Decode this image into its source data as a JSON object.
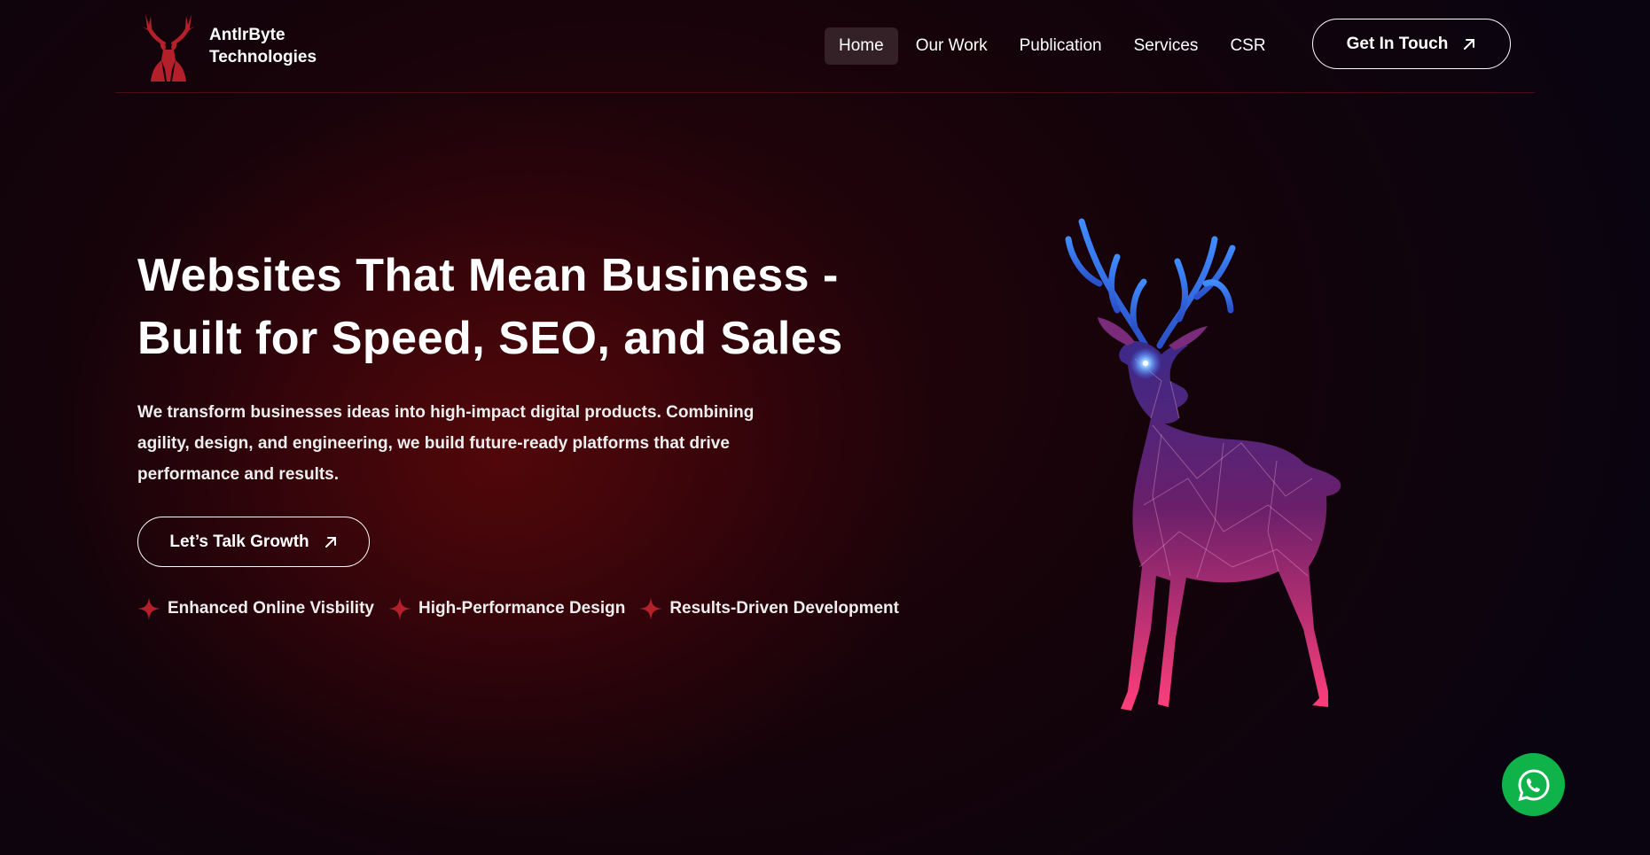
{
  "brand": {
    "name_line1": "AntlrByte",
    "name_line2": "Technologies",
    "logo_icon": "deer-head-icon",
    "accent_color": "#b3202a"
  },
  "nav": {
    "items": [
      {
        "label": "Home",
        "active": true
      },
      {
        "label": "Our Work",
        "active": false
      },
      {
        "label": "Publication",
        "active": false
      },
      {
        "label": "Services",
        "active": false
      },
      {
        "label": "CSR",
        "active": false
      }
    ],
    "cta_label": "Get In Touch",
    "cta_icon": "arrow-up-right-icon"
  },
  "hero": {
    "title_line1": "Websites That Mean Business -",
    "title_line2": "Built for Speed, SEO, and Sales",
    "description": "We transform businesses ideas into high-impact digital products. Combining agility, design, and engineering, we build future-ready platforms that drive performance and results.",
    "cta_label": "Let’s Talk Growth",
    "cta_icon": "arrow-up-right-icon",
    "features": [
      "Enhanced Online Visbility",
      "High-Performance Design",
      "Results-Driven Development"
    ],
    "feature_icon": "four-point-star-icon",
    "illustration": "geometric-deer-illustration"
  },
  "floating": {
    "whatsapp_icon": "whatsapp-icon",
    "whatsapp_color": "#0fb34a"
  }
}
